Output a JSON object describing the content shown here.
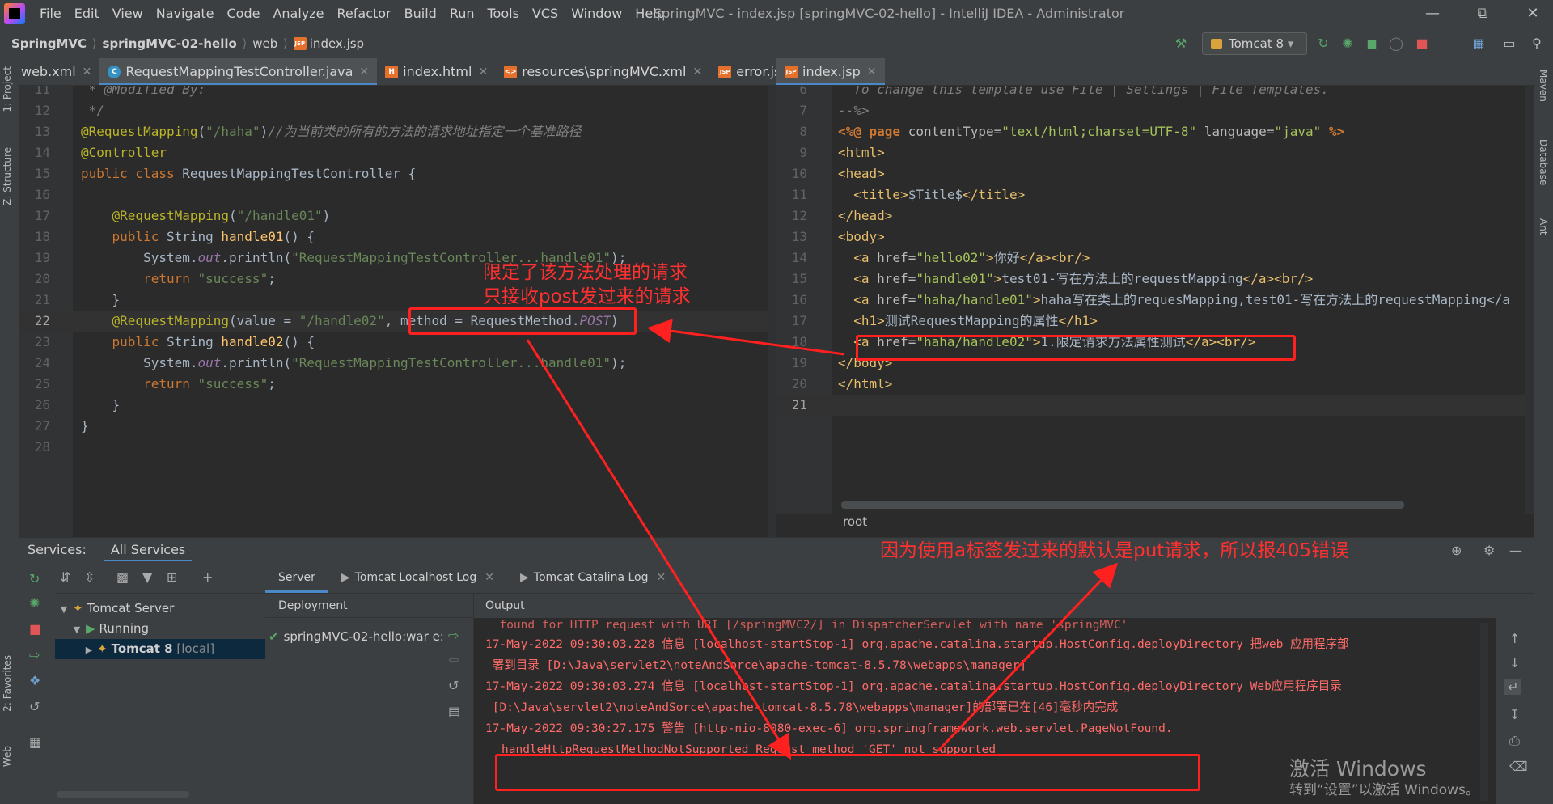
{
  "window": {
    "title": "SpringMVC - index.jsp [springMVC-02-hello] - IntelliJ IDEA - Administrator",
    "menu": [
      "File",
      "Edit",
      "View",
      "Navigate",
      "Code",
      "Analyze",
      "Refactor",
      "Build",
      "Run",
      "Tools",
      "VCS",
      "Window",
      "Help"
    ]
  },
  "navbar": {
    "crumbs": [
      "SpringMVC",
      "springMVC-02-hello",
      "web",
      "index.jsp"
    ],
    "run_config": "Tomcat 8"
  },
  "left_tool_tabs": [
    "1: Project",
    "Z: Structure",
    "2: Favorites",
    "Web"
  ],
  "right_tool_tabs": [
    "Maven",
    "Database",
    "Ant"
  ],
  "left_editor": {
    "tabs": [
      {
        "label": "web.xml",
        "icon": "xml-file-icon"
      },
      {
        "label": "RequestMappingTestController.java",
        "icon": "java-class-icon",
        "active": true
      },
      {
        "label": "index.html",
        "icon": "html-file-icon"
      },
      {
        "label": "resources\\springMVC.xml",
        "icon": "xml-file-icon"
      },
      {
        "label": "error.jsp",
        "icon": "jsp-file-icon"
      }
    ],
    "line_numbers": [
      "11",
      "12",
      "13",
      "14",
      "15",
      "16",
      "17",
      "18",
      "19",
      "20",
      "21",
      "22",
      "23",
      "24",
      "25",
      "26",
      "27",
      "28"
    ]
  },
  "right_editor": {
    "tabs": [
      {
        "label": "index.jsp",
        "icon": "jsp-file-icon",
        "active": true
      }
    ],
    "line_numbers": [
      "6",
      "7",
      "8",
      "9",
      "10",
      "11",
      "12",
      "13",
      "14",
      "15",
      "16",
      "17",
      "18",
      "19",
      "20",
      "21"
    ],
    "breadcrumb": "root"
  },
  "services": {
    "title": "Services:",
    "tab": "All Services",
    "tree": {
      "root": "Tomcat Server",
      "state": "Running",
      "instance": "Tomcat 8",
      "instance_suffix": "[local]"
    },
    "log_tabs": [
      "Server",
      "Tomcat Localhost Log",
      "Tomcat Catalina Log"
    ],
    "deployment_header": "Deployment",
    "deployment_item": "springMVC-02-hello:war e:",
    "output_header": "Output",
    "log_lines": [
      "17-May-2022 09:30:03.228 信息 [localhost-startStop-1] org.apache.catalina.startup.HostConfig.deployDirectory 把web 应用程序部",
      " 署到目录 [D:\\Java\\servlet2\\noteAndSorce\\apache-tomcat-8.5.78\\webapps\\manager]",
      "17-May-2022 09:30:03.274 信息 [localhost-startStop-1] org.apache.catalina.startup.HostConfig.deployDirectory Web应用程序目录",
      " [D:\\Java\\servlet2\\noteAndSorce\\apache-tomcat-8.5.78\\webapps\\manager]的部署已在[46]毫秒内完成",
      "17-May-2022 09:30:27.175 警告 [http-nio-8080-exec-6] org.springframework.web.servlet.PageNotFound.",
      "handleHttpRequestMethodNotSupported Request method 'GET' not supported"
    ],
    "log_partial_top": "  found for HTTP request with URI [/springMVC2/] in DispatcherServlet with name 'springMVC'"
  },
  "annotations": {
    "note_method_line1": "限定了该方法处理的请求",
    "note_method_line2": "只接收post发过来的请求",
    "note_405": "因为使用a标签发过来的默认是put请求，所以报405错误",
    "color": "#ff2020"
  },
  "watermark": {
    "line1": "激活 Windows",
    "line2": "转到“设置”以激活 Windows。"
  },
  "colors": {
    "accent": "#4a88c7",
    "keyword": "#cc7832",
    "string": "#6a8759",
    "annotation": "#bbb529",
    "error_log": "#ff6b68"
  }
}
